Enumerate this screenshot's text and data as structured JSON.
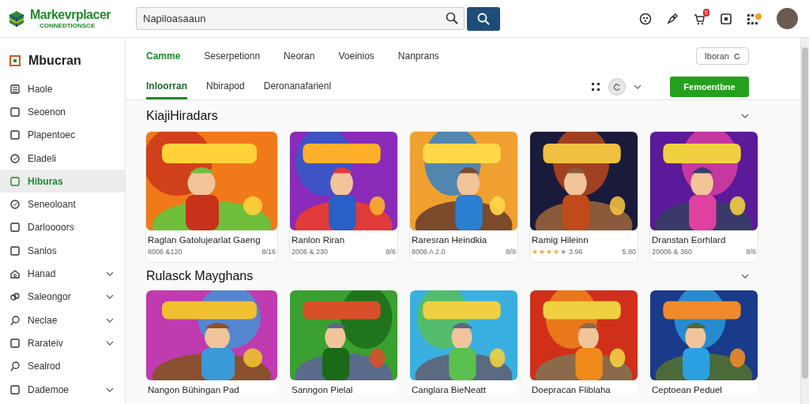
{
  "header": {
    "logo_title": "Markevrplacer",
    "logo_subtitle": "CONNEDTIONSCE",
    "search": {
      "value": "Napiloasaaun"
    },
    "notification_badge": "6"
  },
  "sidebar": {
    "title": "Mbucran",
    "items": [
      {
        "label": "Haole",
        "selected": false,
        "expandable": false
      },
      {
        "label": "Seoenon",
        "selected": false,
        "expandable": false
      },
      {
        "label": "Plapentoec",
        "selected": false,
        "expandable": false
      },
      {
        "label": "Eladeli",
        "selected": false,
        "expandable": false
      },
      {
        "label": "Hiburas",
        "selected": true,
        "expandable": false
      },
      {
        "label": "Seneoloant",
        "selected": false,
        "expandable": false
      },
      {
        "label": "Darloooors",
        "selected": false,
        "expandable": false
      },
      {
        "label": "Sanlos",
        "selected": false,
        "expandable": false
      },
      {
        "label": "Hanad",
        "selected": false,
        "expandable": true
      },
      {
        "label": "Saleongor",
        "selected": false,
        "expandable": true
      },
      {
        "label": "Neclae",
        "selected": false,
        "expandable": true
      },
      {
        "label": "Rarateiv",
        "selected": false,
        "expandable": true
      },
      {
        "label": "Sealrod",
        "selected": false,
        "expandable": false
      },
      {
        "label": "Dademoe",
        "selected": false,
        "expandable": true
      }
    ]
  },
  "tabs": [
    {
      "label": "Camme",
      "selected": true
    },
    {
      "label": "Seserpetionn",
      "selected": false
    },
    {
      "label": "Neoran",
      "selected": false
    },
    {
      "label": "Voeinios",
      "selected": false
    },
    {
      "label": "Nanprans",
      "selected": false
    }
  ],
  "subtabs": [
    {
      "label": "Inloorran",
      "selected": true
    },
    {
      "label": "Nbirapod",
      "selected": false
    },
    {
      "label": "Deronanafarienl",
      "selected": false
    }
  ],
  "filter_button": "Iboran",
  "primary_button": "Femoentbne",
  "sections": [
    {
      "title": "KiajiHiradars",
      "cards": [
        {
          "title": "Raglan Gatolujearlat Gaeng",
          "meta": "8006 &120",
          "price": "8/16"
        },
        {
          "title": "Ranlon Riran",
          "meta": "2006 & 230",
          "price": "8/6"
        },
        {
          "title": "Raresran Heindkia",
          "meta": "8006 A 2.0",
          "price": "8/9"
        },
        {
          "title": "Ramig Hileinn",
          "stars": 4,
          "meta": "3.96",
          "price": "5.80"
        },
        {
          "title": "Dranstan Eorhlard",
          "meta": "20006 & 360",
          "price": "8/6"
        }
      ]
    },
    {
      "title": "Rulasck Mayghans",
      "cards": [
        {
          "title": "Nangon Bühingan Pad"
        },
        {
          "title": "Sanngon Pielal"
        },
        {
          "title": "Canglara BieNeatt"
        },
        {
          "title": "Doepracan Fliblaha"
        },
        {
          "title": "Ceptoean Peduel"
        }
      ]
    }
  ]
}
